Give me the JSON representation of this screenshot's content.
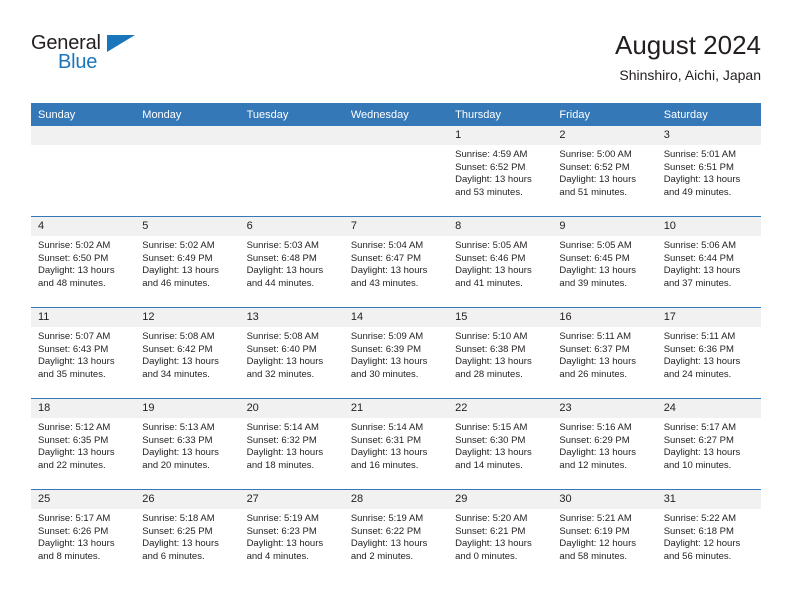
{
  "brand": {
    "name_top": "General",
    "name_bottom": "Blue",
    "flag_color": "#1b75bb"
  },
  "header": {
    "title": "August 2024",
    "subtitle": "Shinshiro, Aichi, Japan"
  },
  "theme": {
    "header_bg": "#3478b8",
    "daynum_bg": "#f1f1f1",
    "text": "#231f20"
  },
  "calendar": {
    "weekday_headers": [
      "Sunday",
      "Monday",
      "Tuesday",
      "Wednesday",
      "Thursday",
      "Friday",
      "Saturday"
    ],
    "weeks": [
      [
        {
          "day": "",
          "sunrise": "",
          "sunset": "",
          "daylight": "",
          "empty": true
        },
        {
          "day": "",
          "sunrise": "",
          "sunset": "",
          "daylight": "",
          "empty": true
        },
        {
          "day": "",
          "sunrise": "",
          "sunset": "",
          "daylight": "",
          "empty": true
        },
        {
          "day": "",
          "sunrise": "",
          "sunset": "",
          "daylight": "",
          "empty": true
        },
        {
          "day": "1",
          "sunrise": "Sunrise: 4:59 AM",
          "sunset": "Sunset: 6:52 PM",
          "daylight": "Daylight: 13 hours and 53 minutes."
        },
        {
          "day": "2",
          "sunrise": "Sunrise: 5:00 AM",
          "sunset": "Sunset: 6:52 PM",
          "daylight": "Daylight: 13 hours and 51 minutes."
        },
        {
          "day": "3",
          "sunrise": "Sunrise: 5:01 AM",
          "sunset": "Sunset: 6:51 PM",
          "daylight": "Daylight: 13 hours and 49 minutes."
        }
      ],
      [
        {
          "day": "4",
          "sunrise": "Sunrise: 5:02 AM",
          "sunset": "Sunset: 6:50 PM",
          "daylight": "Daylight: 13 hours and 48 minutes."
        },
        {
          "day": "5",
          "sunrise": "Sunrise: 5:02 AM",
          "sunset": "Sunset: 6:49 PM",
          "daylight": "Daylight: 13 hours and 46 minutes."
        },
        {
          "day": "6",
          "sunrise": "Sunrise: 5:03 AM",
          "sunset": "Sunset: 6:48 PM",
          "daylight": "Daylight: 13 hours and 44 minutes."
        },
        {
          "day": "7",
          "sunrise": "Sunrise: 5:04 AM",
          "sunset": "Sunset: 6:47 PM",
          "daylight": "Daylight: 13 hours and 43 minutes."
        },
        {
          "day": "8",
          "sunrise": "Sunrise: 5:05 AM",
          "sunset": "Sunset: 6:46 PM",
          "daylight": "Daylight: 13 hours and 41 minutes."
        },
        {
          "day": "9",
          "sunrise": "Sunrise: 5:05 AM",
          "sunset": "Sunset: 6:45 PM",
          "daylight": "Daylight: 13 hours and 39 minutes."
        },
        {
          "day": "10",
          "sunrise": "Sunrise: 5:06 AM",
          "sunset": "Sunset: 6:44 PM",
          "daylight": "Daylight: 13 hours and 37 minutes."
        }
      ],
      [
        {
          "day": "11",
          "sunrise": "Sunrise: 5:07 AM",
          "sunset": "Sunset: 6:43 PM",
          "daylight": "Daylight: 13 hours and 35 minutes."
        },
        {
          "day": "12",
          "sunrise": "Sunrise: 5:08 AM",
          "sunset": "Sunset: 6:42 PM",
          "daylight": "Daylight: 13 hours and 34 minutes."
        },
        {
          "day": "13",
          "sunrise": "Sunrise: 5:08 AM",
          "sunset": "Sunset: 6:40 PM",
          "daylight": "Daylight: 13 hours and 32 minutes."
        },
        {
          "day": "14",
          "sunrise": "Sunrise: 5:09 AM",
          "sunset": "Sunset: 6:39 PM",
          "daylight": "Daylight: 13 hours and 30 minutes."
        },
        {
          "day": "15",
          "sunrise": "Sunrise: 5:10 AM",
          "sunset": "Sunset: 6:38 PM",
          "daylight": "Daylight: 13 hours and 28 minutes."
        },
        {
          "day": "16",
          "sunrise": "Sunrise: 5:11 AM",
          "sunset": "Sunset: 6:37 PM",
          "daylight": "Daylight: 13 hours and 26 minutes."
        },
        {
          "day": "17",
          "sunrise": "Sunrise: 5:11 AM",
          "sunset": "Sunset: 6:36 PM",
          "daylight": "Daylight: 13 hours and 24 minutes."
        }
      ],
      [
        {
          "day": "18",
          "sunrise": "Sunrise: 5:12 AM",
          "sunset": "Sunset: 6:35 PM",
          "daylight": "Daylight: 13 hours and 22 minutes."
        },
        {
          "day": "19",
          "sunrise": "Sunrise: 5:13 AM",
          "sunset": "Sunset: 6:33 PM",
          "daylight": "Daylight: 13 hours and 20 minutes."
        },
        {
          "day": "20",
          "sunrise": "Sunrise: 5:14 AM",
          "sunset": "Sunset: 6:32 PM",
          "daylight": "Daylight: 13 hours and 18 minutes."
        },
        {
          "day": "21",
          "sunrise": "Sunrise: 5:14 AM",
          "sunset": "Sunset: 6:31 PM",
          "daylight": "Daylight: 13 hours and 16 minutes."
        },
        {
          "day": "22",
          "sunrise": "Sunrise: 5:15 AM",
          "sunset": "Sunset: 6:30 PM",
          "daylight": "Daylight: 13 hours and 14 minutes."
        },
        {
          "day": "23",
          "sunrise": "Sunrise: 5:16 AM",
          "sunset": "Sunset: 6:29 PM",
          "daylight": "Daylight: 13 hours and 12 minutes."
        },
        {
          "day": "24",
          "sunrise": "Sunrise: 5:17 AM",
          "sunset": "Sunset: 6:27 PM",
          "daylight": "Daylight: 13 hours and 10 minutes."
        }
      ],
      [
        {
          "day": "25",
          "sunrise": "Sunrise: 5:17 AM",
          "sunset": "Sunset: 6:26 PM",
          "daylight": "Daylight: 13 hours and 8 minutes."
        },
        {
          "day": "26",
          "sunrise": "Sunrise: 5:18 AM",
          "sunset": "Sunset: 6:25 PM",
          "daylight": "Daylight: 13 hours and 6 minutes."
        },
        {
          "day": "27",
          "sunrise": "Sunrise: 5:19 AM",
          "sunset": "Sunset: 6:23 PM",
          "daylight": "Daylight: 13 hours and 4 minutes."
        },
        {
          "day": "28",
          "sunrise": "Sunrise: 5:19 AM",
          "sunset": "Sunset: 6:22 PM",
          "daylight": "Daylight: 13 hours and 2 minutes."
        },
        {
          "day": "29",
          "sunrise": "Sunrise: 5:20 AM",
          "sunset": "Sunset: 6:21 PM",
          "daylight": "Daylight: 13 hours and 0 minutes."
        },
        {
          "day": "30",
          "sunrise": "Sunrise: 5:21 AM",
          "sunset": "Sunset: 6:19 PM",
          "daylight": "Daylight: 12 hours and 58 minutes."
        },
        {
          "day": "31",
          "sunrise": "Sunrise: 5:22 AM",
          "sunset": "Sunset: 6:18 PM",
          "daylight": "Daylight: 12 hours and 56 minutes."
        }
      ]
    ]
  }
}
